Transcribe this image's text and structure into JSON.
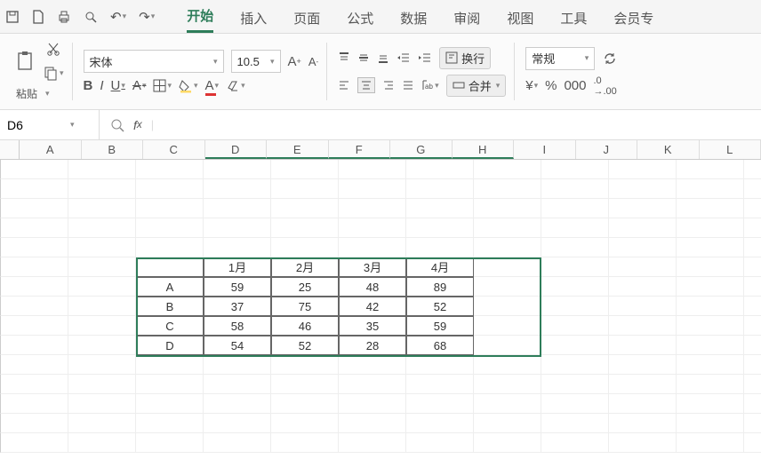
{
  "qat_icons": [
    "save-icon",
    "print-icon",
    "print-preview-icon",
    "undo-icon",
    "redo-icon"
  ],
  "menu": {
    "tabs": [
      "开始",
      "插入",
      "页面",
      "公式",
      "数据",
      "审阅",
      "视图",
      "工具",
      "会员专"
    ],
    "active": 0
  },
  "clipboard": {
    "paste": "粘贴"
  },
  "font": {
    "name": "宋体",
    "size": "10.5"
  },
  "align": {
    "wrap": "换行",
    "merge": "合并"
  },
  "number": {
    "format": "常规",
    "currency": "¥",
    "percent": "%",
    "decimals": "000"
  },
  "namebox": "D6",
  "columns": [
    "A",
    "B",
    "C",
    "D",
    "E",
    "F",
    "G",
    "H",
    "I",
    "J",
    "K",
    "L"
  ],
  "chart_data": {
    "type": "table",
    "title": "",
    "headers": [
      "",
      "1月",
      "2月",
      "3月",
      "4月"
    ],
    "rows": [
      {
        "label": "A",
        "values": [
          59,
          25,
          48,
          89
        ]
      },
      {
        "label": "B",
        "values": [
          37,
          75,
          42,
          52
        ]
      },
      {
        "label": "C",
        "values": [
          58,
          46,
          35,
          59
        ]
      },
      {
        "label": "D",
        "values": [
          54,
          52,
          28,
          68
        ]
      }
    ]
  }
}
